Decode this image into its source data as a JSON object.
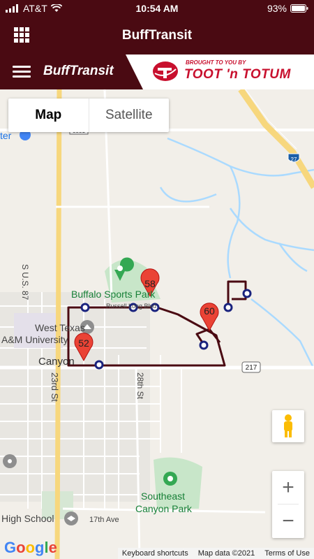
{
  "status_bar": {
    "carrier": "AT&T",
    "time": "10:54 AM",
    "battery": "93%"
  },
  "header": {
    "title": "BuffTransit"
  },
  "banner": {
    "brand": "BuffTransit",
    "sponsor_tagline": "BROUGHT TO YOU BY",
    "sponsor_name": "TOOT 'n TOTUM"
  },
  "map_type": {
    "map_label": "Map",
    "satellite_label": "Satellite",
    "selected": "Map"
  },
  "map": {
    "labels": {
      "sports_park": "Buffalo Sports Park",
      "russell": "Russell Long Blvd",
      "west_texas": "West Texas",
      "am_university": "A&M University",
      "canyon": "Canyon",
      "us87": "S U.S. 87",
      "street_23rd": "23rd St",
      "street_28th": "28th St",
      "southeast_park_1": "Southeast",
      "southeast_park_2": "Canyon Park",
      "high_school": "High School",
      "ave_17th": "17th Ave",
      "hwy_217": "217",
      "i27": "27",
      "hwy_3331": "3331",
      "partial_label": "ter"
    },
    "markers": [
      {
        "label": "58"
      },
      {
        "label": "60"
      },
      {
        "label": "52"
      }
    ],
    "route_color": "#4a0a12",
    "marker_color": "#ea4335",
    "stop_color": "#1a237e"
  },
  "controls": {
    "zoom_in": "+",
    "zoom_out": "−"
  },
  "google_logo": "Google",
  "attribution": {
    "shortcuts": "Keyboard shortcuts",
    "map_data": "Map data ©2021",
    "terms": "Terms of Use"
  }
}
